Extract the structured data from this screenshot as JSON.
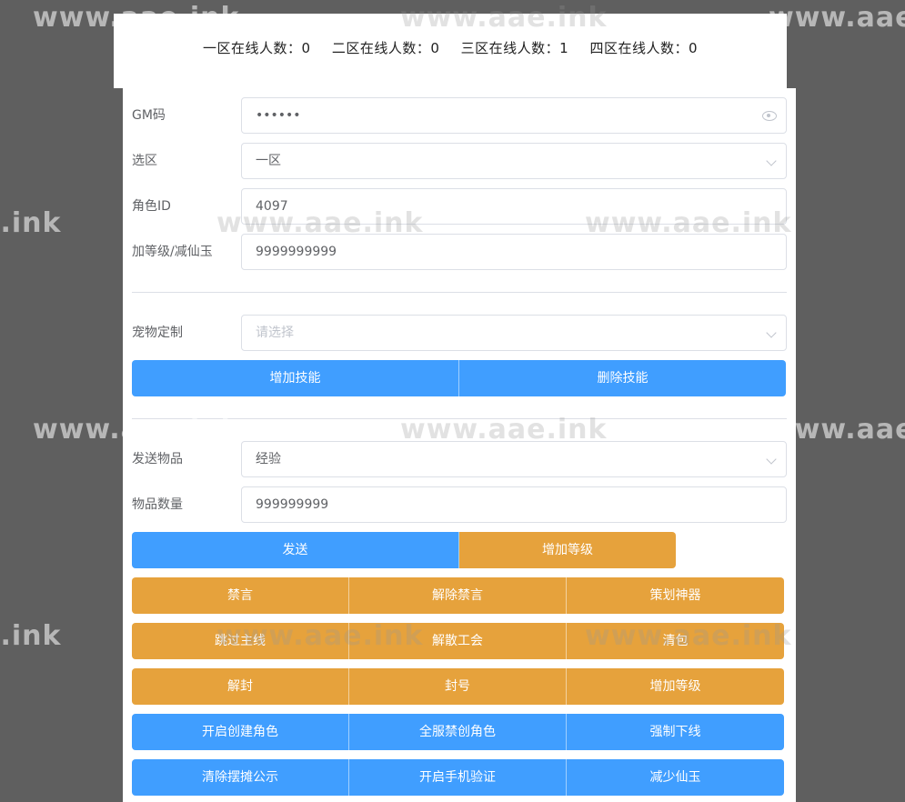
{
  "online": {
    "zone1": "一区在线人数：0",
    "zone2": "二区在线人数：0",
    "zone3": "三区在线人数：1",
    "zone4": "四区在线人数：0"
  },
  "form": {
    "gm_label": "GM码",
    "gm_value": "••••••",
    "zone_label": "选区",
    "zone_value": "一区",
    "role_label": "角色ID",
    "role_value": "4097",
    "level_label": "加等级/减仙玉",
    "level_value": "9999999999",
    "pet_label": "宠物定制",
    "pet_placeholder": "请选择",
    "item_label": "发送物品",
    "item_value": "经验",
    "qty_label": "物品数量",
    "qty_value": "999999999"
  },
  "buttons": {
    "add_skill": "增加技能",
    "remove_skill": "删除技能",
    "send": "发送",
    "add_level": "增加等级",
    "mute": "禁言",
    "unmute": "解除禁言",
    "planner_artifact": "策划神器",
    "skip_main_quest": "跳过主线",
    "disband_guild": "解散工会",
    "clear_bag": "清包",
    "unban": "解封",
    "ban": "封号",
    "add_level_2": "增加等级",
    "enable_create_role": "开启创建角色",
    "disable_create_role": "全服禁创角色",
    "force_offline": "强制下线",
    "clear_stall_notice": "清除摆摊公示",
    "enable_phone_verify": "开启手机验证",
    "reduce_jade": "减少仙玉"
  },
  "watermark": "www.aae.ink",
  "colors": {
    "primary": "#409eff",
    "warning": "#e6a23c",
    "background": "#5f5f5f"
  }
}
